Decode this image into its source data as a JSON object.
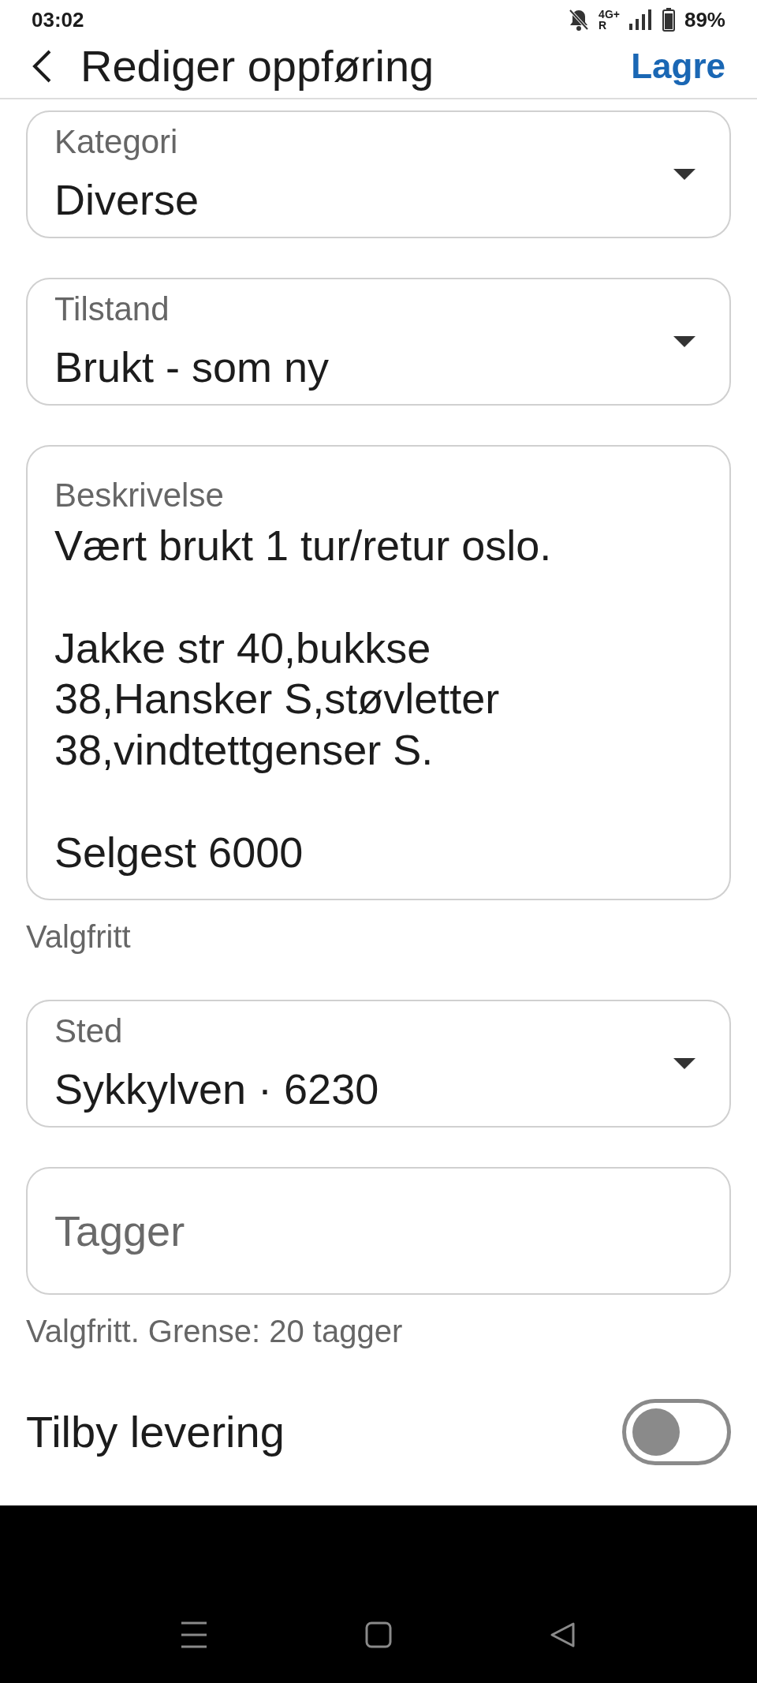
{
  "status_bar": {
    "time": "03:02",
    "network": "4G+",
    "roaming": "R",
    "battery": "89%"
  },
  "header": {
    "title": "Rediger oppføring",
    "save": "Lagre"
  },
  "fields": [
    {
      "kind": "select",
      "label": "Kategori",
      "value": "Diverse"
    },
    {
      "kind": "select",
      "label": "Tilstand",
      "value": "Brukt - som ny"
    },
    {
      "kind": "textarea",
      "label": "Beskrivelse",
      "value": "Vært brukt 1 tur/retur oslo.\n\nJakke str 40,bukkse 38,Hansker S,støvletter 38,vindtettgenser S.\n\nSelgest 6000",
      "helper": "Valgfritt"
    },
    {
      "kind": "select",
      "label": "Sted",
      "value": "Sykkylven · 6230"
    },
    {
      "kind": "text",
      "placeholder": "Tagger",
      "helper": "Valgfritt. Grense: 20 tagger"
    }
  ],
  "delivery": {
    "label": "Tilby levering",
    "on": false
  }
}
